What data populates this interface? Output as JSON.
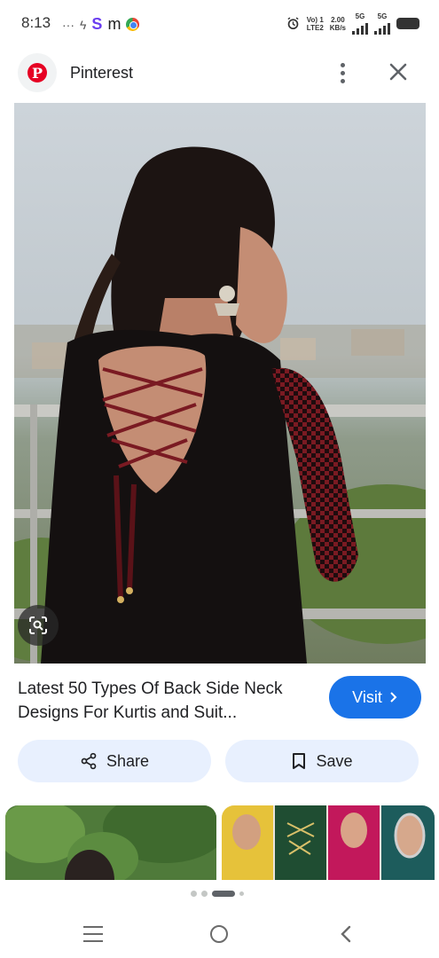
{
  "status_bar": {
    "time": "8:13",
    "volte_top": "Vo) 1",
    "volte_bottom": "LTE2",
    "speed_top": "2.00",
    "speed_bottom": "KB/s",
    "net1": "5G",
    "net2": "5G"
  },
  "header": {
    "site_name": "Pinterest",
    "logo_letter": "P"
  },
  "result": {
    "title": "Latest 50 Types Of Back Side Neck Designs For Kurtis and Suit...",
    "visit_label": "Visit",
    "share_label": "Share",
    "save_label": "Save"
  },
  "colors": {
    "accent": "#1a73e8",
    "pinterest_red": "#e60023",
    "chip_bg": "#e8f0fe"
  },
  "icons": [
    "pinterest-logo-icon",
    "more-vert-icon",
    "close-icon",
    "lens-icon",
    "chevron-right-icon",
    "share-icon",
    "bookmark-icon",
    "menu-icon",
    "home-icon",
    "back-icon"
  ],
  "pager": {
    "count": 4,
    "active_index": 2
  }
}
